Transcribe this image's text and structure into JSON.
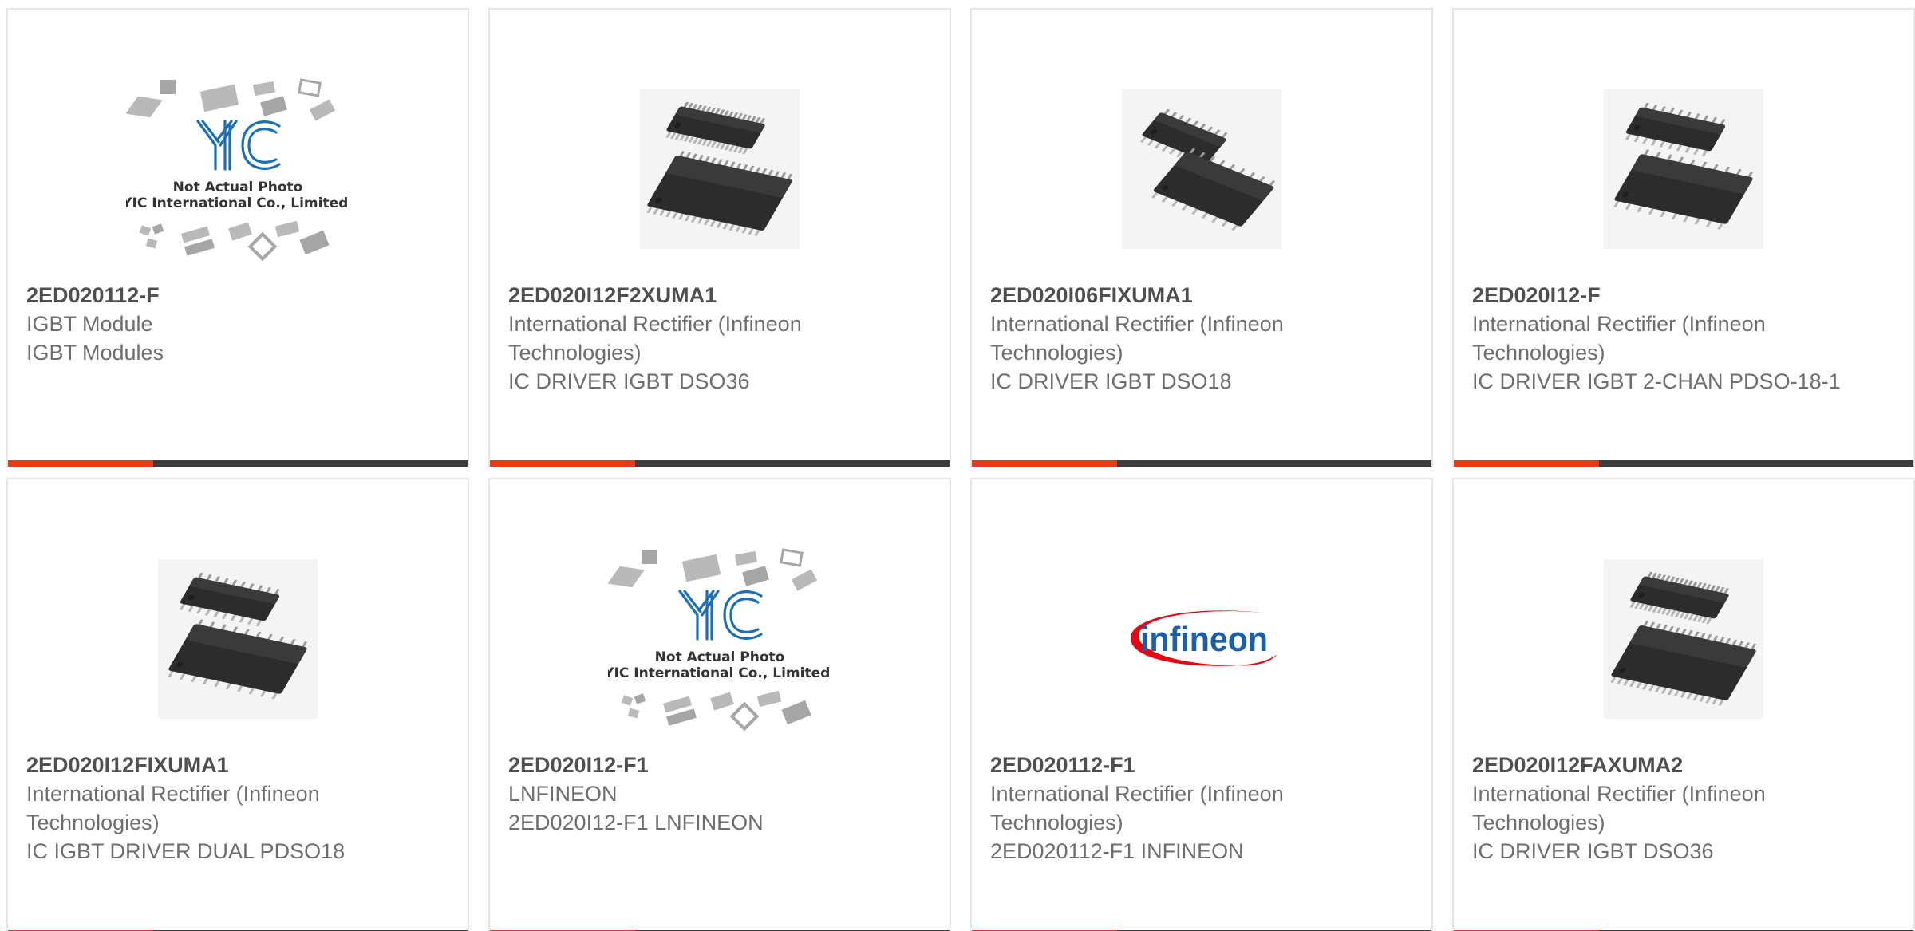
{
  "products": [
    {
      "part": "2ED020112-F",
      "manufacturer": "IGBT Module",
      "description": "IGBT Modules",
      "image": "yic-placeholder"
    },
    {
      "part": "2ED020I12F2XUMA1",
      "manufacturer": "International Rectifier (Infineon Technologies)",
      "description": "IC DRIVER IGBT DSO36",
      "image": "ssop36-chip"
    },
    {
      "part": "2ED020I06FIXUMA1",
      "manufacturer": "International Rectifier (Infineon Technologies)",
      "description": "IC DRIVER IGBT DSO18",
      "image": "dso18-chip"
    },
    {
      "part": "2ED020I12-F",
      "manufacturer": "International Rectifier (Infineon Technologies)",
      "description": "IC DRIVER IGBT 2-CHAN PDSO-18-1",
      "image": "soic-chip"
    },
    {
      "part": "2ED020I12FIXUMA1",
      "manufacturer": "International Rectifier (Infineon Technologies)",
      "description": "IC IGBT DRIVER DUAL PDSO18",
      "image": "soic-chip"
    },
    {
      "part": "2ED020I12-F1",
      "manufacturer": "LNFINEON",
      "description": "2ED020I12-F1 LNFINEON",
      "image": "yic-placeholder"
    },
    {
      "part": "2ED020112-F1",
      "manufacturer": "International Rectifier (Infineon Technologies)",
      "description": "2ED020112-F1 INFINEON",
      "image": "infineon-logo"
    },
    {
      "part": "2ED020I12FAXUMA2",
      "manufacturer": "International Rectifier (Infineon Technologies)",
      "description": "IC DRIVER IGBT DSO36",
      "image": "ssop36-chip"
    }
  ],
  "placeholder": {
    "logo": "YIC",
    "line1": "Not Actual Photo",
    "line2": "YIC International Co., Limited."
  },
  "brand_logo_text": "infineon",
  "colors": {
    "accent": "#e63b14",
    "bar": "#3c3c3c",
    "border": "#e6e6e6",
    "part_text": "#4f4f4f",
    "body_text": "#6e6e6e",
    "infineon_blue": "#1b5faa",
    "infineon_red": "#e30613",
    "yic_blue": "#1a6fb5"
  }
}
